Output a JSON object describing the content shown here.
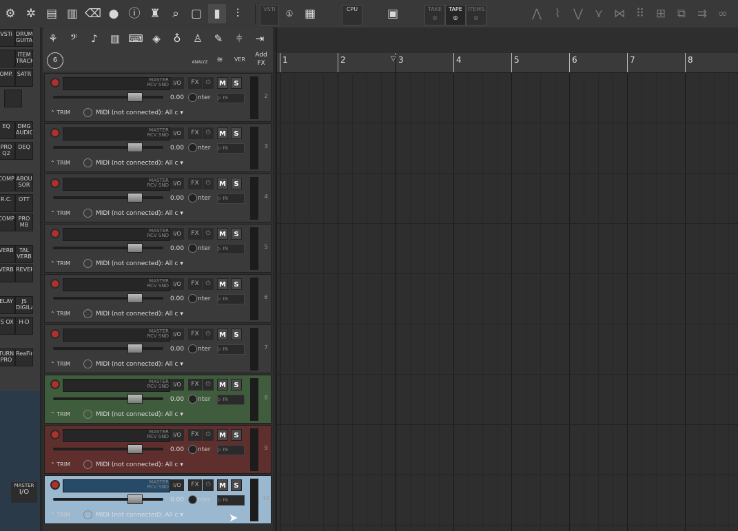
{
  "toolbar": {
    "left_icons": [
      "gear-icon",
      "settings-icon",
      "save-icon",
      "trash-icon",
      "eraser-icon",
      "sws-icon",
      "info-icon",
      "shirt-icon",
      "search-icon",
      "window-icon",
      "wave-icon",
      "mixer-icon"
    ],
    "vsti_label": "VSTi",
    "cpu_label": "CPU",
    "take_label": "TAKE",
    "tape_label": "TAPE",
    "items_label": "ITEMS",
    "right_icons": [
      "razor-icon",
      "envelope-icon",
      "comp-icon",
      "tool-icon",
      "split-icon",
      "grid-icon",
      "route-icon",
      "window-stack-icon",
      "arrow-icon",
      "link-icon"
    ]
  },
  "fx_buttons": [
    {
      "id": "vsti",
      "text": "VSTi"
    },
    {
      "id": "drum",
      "text": "DRUM GUITAR"
    },
    {
      "id": "tool1",
      "text": ""
    },
    {
      "id": "item-track",
      "text": "ITEM TRACK"
    },
    {
      "id": "comp",
      "text": "OMP."
    },
    {
      "id": "satr",
      "text": "SATR"
    },
    {
      "id": "mic",
      "text": ""
    },
    {
      "id": "eq",
      "text": "EQ"
    },
    {
      "id": "dmg",
      "text": "DMG AUDIO"
    },
    {
      "id": "q2",
      "text": "PRO Q2"
    },
    {
      "id": "deq",
      "text": "DEQ"
    },
    {
      "id": "comp2",
      "text": "COMP"
    },
    {
      "id": "abou",
      "text": "ABOU SOR"
    },
    {
      "id": "rc",
      "text": "R.C."
    },
    {
      "id": "ott",
      "text": "OTT"
    },
    {
      "id": "comp3",
      "text": "COMP"
    },
    {
      "id": "mb",
      "text": "PRO MB"
    },
    {
      "id": "verb",
      "text": "VERB"
    },
    {
      "id": "tal",
      "text": "TAL VERB"
    },
    {
      "id": "verb2",
      "text": "VERB"
    },
    {
      "id": "reverb",
      "text": "REVERB"
    },
    {
      "id": "delay",
      "text": "ELAY"
    },
    {
      "id": "digilay",
      "text": "JS DIGILAY"
    },
    {
      "id": "ox",
      "text": "JS OX"
    },
    {
      "id": "hd",
      "text": "H-D"
    },
    {
      "id": "turn",
      "text": "TURN PRO"
    },
    {
      "id": "reafir",
      "text": "ReaFir"
    }
  ],
  "bottom_left": {
    "master_label": "MASTER",
    "io_label": "I/O"
  },
  "tcp_tools": {
    "icons": [
      "drums-icon",
      "bass-clef-icon",
      "guitar-icon",
      "piano-icon",
      "keyboard-icon",
      "synth-icon",
      "mic-icon",
      "person-icon",
      "pencil-icon",
      "eq-icon",
      "arrow-right-icon"
    ],
    "circle_label": "6",
    "analyz_label": "ANALYZ",
    "ver_label": "VER",
    "addfx_label": "Add FX"
  },
  "track_common": {
    "master_line1": "MASTER",
    "master_line2": "RCV SND",
    "io": "I/O",
    "fx": "FX",
    "mute": "M",
    "solo": "S",
    "volume": "0.00",
    "pan_label": "nter",
    "in_label": "IN",
    "trim": "TRIM",
    "midi": "MIDI (not connected): All c"
  },
  "tracks": [
    {
      "num": "2",
      "color": "default"
    },
    {
      "num": "3",
      "color": "default"
    },
    {
      "num": "4",
      "color": "default"
    },
    {
      "num": "5",
      "color": "default"
    },
    {
      "num": "6",
      "color": "default"
    },
    {
      "num": "7",
      "color": "default"
    },
    {
      "num": "8",
      "color": "green"
    },
    {
      "num": "9",
      "color": "red"
    },
    {
      "num": "10",
      "color": "blue"
    }
  ],
  "ruler": {
    "bars": [
      "1",
      "2",
      "3",
      "4",
      "5",
      "6",
      "7",
      "8"
    ]
  }
}
